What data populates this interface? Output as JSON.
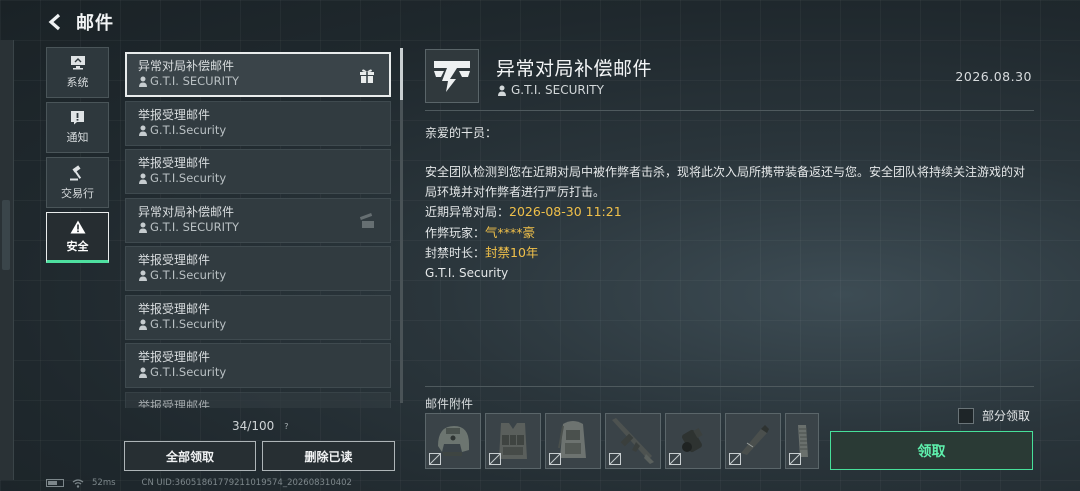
{
  "header": {
    "title": "邮件"
  },
  "categories": [
    {
      "label": "系统",
      "icon": "monitor-icon"
    },
    {
      "label": "通知",
      "icon": "alert-box-icon"
    },
    {
      "label": "交易行",
      "icon": "gavel-icon"
    },
    {
      "label": "安全",
      "icon": "warning-triangle-icon",
      "active": true
    }
  ],
  "mails": [
    {
      "subject": "异常对局补偿邮件",
      "sender": "G.T.I. SECURITY",
      "gift": true,
      "selected": true
    },
    {
      "subject": "举报受理邮件",
      "sender": "G.T.I.Security"
    },
    {
      "subject": "举报受理邮件",
      "sender": "G.T.I.Security"
    },
    {
      "subject": "异常对局补偿邮件",
      "sender": "G.T.I. SECURITY",
      "gift": true,
      "gift_dim": true
    },
    {
      "subject": "举报受理邮件",
      "sender": "G.T.I.Security"
    },
    {
      "subject": "举报受理邮件",
      "sender": "G.T.I.Security"
    },
    {
      "subject": "举报受理邮件",
      "sender": "G.T.I.Security"
    },
    {
      "subject": "举报受理邮件",
      "sender": ""
    }
  ],
  "list_footer": {
    "count": "34/100",
    "help": "?"
  },
  "buttons": {
    "claim_all": "全部领取",
    "delete_read": "删除已读",
    "claim": "领取",
    "partial_claim": "部分领取"
  },
  "status": {
    "ping": "52ms",
    "uid": "CN UID:360518617792110195​74_202608310402"
  },
  "detail": {
    "title": "异常对局补偿邮件",
    "sender": "G.T.I. SECURITY",
    "date": "2026.08.30",
    "greeting": "亲爱的干员：",
    "paragraph": "安全团队检测到您在近期对局中被作弊者击杀，现将此次入局所携带装备返还与您。安全团队将持续关注游戏的对局环境并对作弊者进行严厉打击。",
    "match_label": "近期异常对局：",
    "match_value": "2026-08-30 11:21",
    "cheater_label": "作弊玩家：",
    "cheater_value": "气****豪",
    "ban_label": "封禁时长：",
    "ban_value": "封禁10年",
    "signature": "G.T.I. Security"
  },
  "attachments": {
    "label": "邮件附件",
    "items": [
      {
        "icon": "helmet-icon"
      },
      {
        "icon": "tactical-vest-icon"
      },
      {
        "icon": "backpack-icon"
      },
      {
        "icon": "rifle-icon"
      },
      {
        "icon": "scope-icon"
      },
      {
        "icon": "knife-icon"
      },
      {
        "icon": "magazine-icon"
      }
    ]
  },
  "colors": {
    "accent": "#47e09a",
    "highlight": "#f0c04a"
  }
}
